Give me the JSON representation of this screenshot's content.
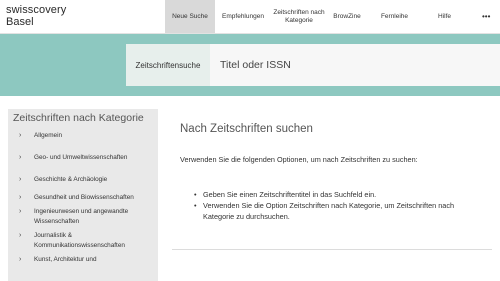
{
  "logo": {
    "line1": "swisscovery",
    "line2": "Basel"
  },
  "nav": {
    "items": [
      {
        "label": "Neue Suche"
      },
      {
        "label": "Empfehlungen"
      },
      {
        "label": "Zeitschriften nach Kategorie"
      },
      {
        "label": "BrowZine"
      },
      {
        "label": "Fernleihe"
      },
      {
        "label": "Hilfe"
      }
    ],
    "more_glyph": "•••"
  },
  "search": {
    "tab_label": "Zeitschriftensuche",
    "placeholder": "Titel oder ISSN",
    "value": ""
  },
  "sidebar": {
    "title": "Zeitschriften nach Kategorie",
    "items": [
      {
        "label": "Allgemein"
      },
      {
        "label": "Geo- und Umweltwissenschaften"
      },
      {
        "label": "Geschichte & Archäologie"
      },
      {
        "label": "Gesundheit und Biowissenschaften"
      },
      {
        "label": "Ingenieurwesen und angewandte Wissenschaften"
      },
      {
        "label": "Journalistik & Kommunikationswissenschaften"
      },
      {
        "label": "Kunst, Architektur und"
      }
    ]
  },
  "main": {
    "title": "Nach Zeitschriften suchen",
    "description": "Verwenden Sie die folgenden Optionen, um nach Zeitschriften zu suchen:",
    "options": [
      {
        "text": "Geben Sie einen Zeitschriftentitel in das Suchfeld ein."
      },
      {
        "text": "Verwenden Sie die Option Zeitschriften nach Kategorie, um Zeitschriften nach Kategorie zu durchsuchen."
      }
    ]
  },
  "colors": {
    "search_band": "#8dc8c0",
    "active_nav": "#d9d9d9",
    "sidebar_bg": "#e9e9e9"
  }
}
